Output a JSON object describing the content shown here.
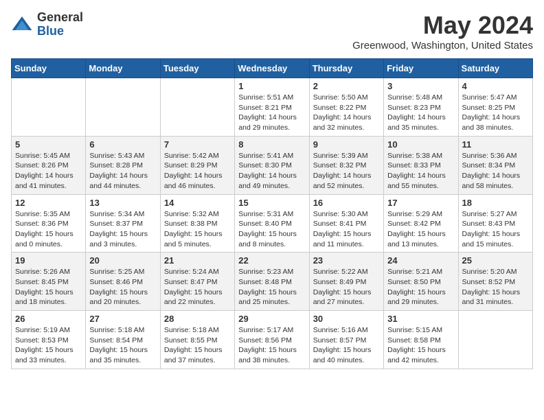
{
  "header": {
    "logo_general": "General",
    "logo_blue": "Blue",
    "month_title": "May 2024",
    "location": "Greenwood, Washington, United States"
  },
  "weekdays": [
    "Sunday",
    "Monday",
    "Tuesday",
    "Wednesday",
    "Thursday",
    "Friday",
    "Saturday"
  ],
  "weeks": [
    [
      {
        "day": "",
        "sunrise": "",
        "sunset": "",
        "daylight": ""
      },
      {
        "day": "",
        "sunrise": "",
        "sunset": "",
        "daylight": ""
      },
      {
        "day": "",
        "sunrise": "",
        "sunset": "",
        "daylight": ""
      },
      {
        "day": "1",
        "sunrise": "Sunrise: 5:51 AM",
        "sunset": "Sunset: 8:21 PM",
        "daylight": "Daylight: 14 hours and 29 minutes."
      },
      {
        "day": "2",
        "sunrise": "Sunrise: 5:50 AM",
        "sunset": "Sunset: 8:22 PM",
        "daylight": "Daylight: 14 hours and 32 minutes."
      },
      {
        "day": "3",
        "sunrise": "Sunrise: 5:48 AM",
        "sunset": "Sunset: 8:23 PM",
        "daylight": "Daylight: 14 hours and 35 minutes."
      },
      {
        "day": "4",
        "sunrise": "Sunrise: 5:47 AM",
        "sunset": "Sunset: 8:25 PM",
        "daylight": "Daylight: 14 hours and 38 minutes."
      }
    ],
    [
      {
        "day": "5",
        "sunrise": "Sunrise: 5:45 AM",
        "sunset": "Sunset: 8:26 PM",
        "daylight": "Daylight: 14 hours and 41 minutes."
      },
      {
        "day": "6",
        "sunrise": "Sunrise: 5:43 AM",
        "sunset": "Sunset: 8:28 PM",
        "daylight": "Daylight: 14 hours and 44 minutes."
      },
      {
        "day": "7",
        "sunrise": "Sunrise: 5:42 AM",
        "sunset": "Sunset: 8:29 PM",
        "daylight": "Daylight: 14 hours and 46 minutes."
      },
      {
        "day": "8",
        "sunrise": "Sunrise: 5:41 AM",
        "sunset": "Sunset: 8:30 PM",
        "daylight": "Daylight: 14 hours and 49 minutes."
      },
      {
        "day": "9",
        "sunrise": "Sunrise: 5:39 AM",
        "sunset": "Sunset: 8:32 PM",
        "daylight": "Daylight: 14 hours and 52 minutes."
      },
      {
        "day": "10",
        "sunrise": "Sunrise: 5:38 AM",
        "sunset": "Sunset: 8:33 PM",
        "daylight": "Daylight: 14 hours and 55 minutes."
      },
      {
        "day": "11",
        "sunrise": "Sunrise: 5:36 AM",
        "sunset": "Sunset: 8:34 PM",
        "daylight": "Daylight: 14 hours and 58 minutes."
      }
    ],
    [
      {
        "day": "12",
        "sunrise": "Sunrise: 5:35 AM",
        "sunset": "Sunset: 8:36 PM",
        "daylight": "Daylight: 15 hours and 0 minutes."
      },
      {
        "day": "13",
        "sunrise": "Sunrise: 5:34 AM",
        "sunset": "Sunset: 8:37 PM",
        "daylight": "Daylight: 15 hours and 3 minutes."
      },
      {
        "day": "14",
        "sunrise": "Sunrise: 5:32 AM",
        "sunset": "Sunset: 8:38 PM",
        "daylight": "Daylight: 15 hours and 5 minutes."
      },
      {
        "day": "15",
        "sunrise": "Sunrise: 5:31 AM",
        "sunset": "Sunset: 8:40 PM",
        "daylight": "Daylight: 15 hours and 8 minutes."
      },
      {
        "day": "16",
        "sunrise": "Sunrise: 5:30 AM",
        "sunset": "Sunset: 8:41 PM",
        "daylight": "Daylight: 15 hours and 11 minutes."
      },
      {
        "day": "17",
        "sunrise": "Sunrise: 5:29 AM",
        "sunset": "Sunset: 8:42 PM",
        "daylight": "Daylight: 15 hours and 13 minutes."
      },
      {
        "day": "18",
        "sunrise": "Sunrise: 5:27 AM",
        "sunset": "Sunset: 8:43 PM",
        "daylight": "Daylight: 15 hours and 15 minutes."
      }
    ],
    [
      {
        "day": "19",
        "sunrise": "Sunrise: 5:26 AM",
        "sunset": "Sunset: 8:45 PM",
        "daylight": "Daylight: 15 hours and 18 minutes."
      },
      {
        "day": "20",
        "sunrise": "Sunrise: 5:25 AM",
        "sunset": "Sunset: 8:46 PM",
        "daylight": "Daylight: 15 hours and 20 minutes."
      },
      {
        "day": "21",
        "sunrise": "Sunrise: 5:24 AM",
        "sunset": "Sunset: 8:47 PM",
        "daylight": "Daylight: 15 hours and 22 minutes."
      },
      {
        "day": "22",
        "sunrise": "Sunrise: 5:23 AM",
        "sunset": "Sunset: 8:48 PM",
        "daylight": "Daylight: 15 hours and 25 minutes."
      },
      {
        "day": "23",
        "sunrise": "Sunrise: 5:22 AM",
        "sunset": "Sunset: 8:49 PM",
        "daylight": "Daylight: 15 hours and 27 minutes."
      },
      {
        "day": "24",
        "sunrise": "Sunrise: 5:21 AM",
        "sunset": "Sunset: 8:50 PM",
        "daylight": "Daylight: 15 hours and 29 minutes."
      },
      {
        "day": "25",
        "sunrise": "Sunrise: 5:20 AM",
        "sunset": "Sunset: 8:52 PM",
        "daylight": "Daylight: 15 hours and 31 minutes."
      }
    ],
    [
      {
        "day": "26",
        "sunrise": "Sunrise: 5:19 AM",
        "sunset": "Sunset: 8:53 PM",
        "daylight": "Daylight: 15 hours and 33 minutes."
      },
      {
        "day": "27",
        "sunrise": "Sunrise: 5:18 AM",
        "sunset": "Sunset: 8:54 PM",
        "daylight": "Daylight: 15 hours and 35 minutes."
      },
      {
        "day": "28",
        "sunrise": "Sunrise: 5:18 AM",
        "sunset": "Sunset: 8:55 PM",
        "daylight": "Daylight: 15 hours and 37 minutes."
      },
      {
        "day": "29",
        "sunrise": "Sunrise: 5:17 AM",
        "sunset": "Sunset: 8:56 PM",
        "daylight": "Daylight: 15 hours and 38 minutes."
      },
      {
        "day": "30",
        "sunrise": "Sunrise: 5:16 AM",
        "sunset": "Sunset: 8:57 PM",
        "daylight": "Daylight: 15 hours and 40 minutes."
      },
      {
        "day": "31",
        "sunrise": "Sunrise: 5:15 AM",
        "sunset": "Sunset: 8:58 PM",
        "daylight": "Daylight: 15 hours and 42 minutes."
      },
      {
        "day": "",
        "sunrise": "",
        "sunset": "",
        "daylight": ""
      }
    ]
  ]
}
